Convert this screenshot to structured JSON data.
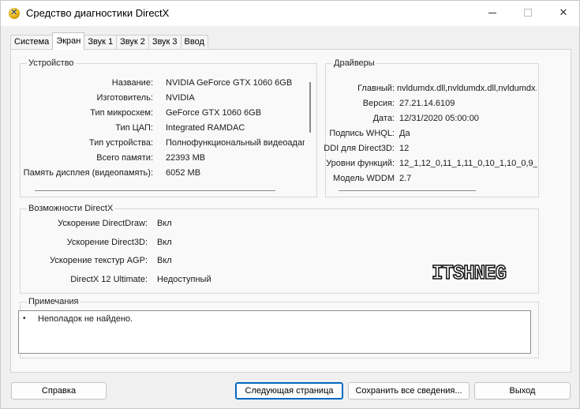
{
  "window": {
    "title": "Средство диагностики DirectX",
    "minimize": "—",
    "maximize": "□",
    "close": "✕"
  },
  "tabs": [
    {
      "label": "Система"
    },
    {
      "label": "Экран",
      "active": true
    },
    {
      "label": "Звук 1"
    },
    {
      "label": "Звук 2"
    },
    {
      "label": "Звук 3"
    },
    {
      "label": "Ввод"
    }
  ],
  "device": {
    "title": "Устройство",
    "rows": [
      {
        "label": "Название:",
        "value": "NVIDIA GeForce GTX 1060 6GB"
      },
      {
        "label": "Изготовитель:",
        "value": "NVIDIA"
      },
      {
        "label": "Тип микросхем:",
        "value": "GeForce GTX 1060 6GB"
      },
      {
        "label": "Тип ЦАП:",
        "value": "Integrated RAMDAC"
      },
      {
        "label": "Тип устройства:",
        "value": "Полнофункциональный видеоадап"
      },
      {
        "label": "Всего памяти:",
        "value": "22393 MB"
      },
      {
        "label": "Память дисплея (видеопамять):",
        "value": "6052 MB"
      }
    ]
  },
  "drivers": {
    "title": "Драйверы",
    "rows": [
      {
        "label": "Главный:",
        "value": "nvldumdx.dll,nvldumdx.dll,nvldumdx.c"
      },
      {
        "label": "Версия:",
        "value": "27.21.14.6109"
      },
      {
        "label": "Дата:",
        "value": "12/31/2020 05:00:00"
      },
      {
        "label": "Подпись WHQL:",
        "value": "Да"
      },
      {
        "label": "DDI для Direct3D:",
        "value": "12"
      },
      {
        "label": "Уровни функций:",
        "value": "12_1,12_0,11_1,11_0,10_1,10_0,9_"
      },
      {
        "label": "Модель WDDM",
        "value": "2.7"
      }
    ]
  },
  "directx": {
    "title": "Возможности DirectX",
    "rows": [
      {
        "label": "Ускорение DirectDraw:",
        "value": "Вкл"
      },
      {
        "label": "Ускорение Direct3D:",
        "value": "Вкл"
      },
      {
        "label": "Ускорение текстур AGP:",
        "value": "Вкл"
      },
      {
        "label": "DirectX 12 Ultimate:",
        "value": "Недоступный"
      }
    ]
  },
  "notes": {
    "title": "Примечания",
    "bullet": "•",
    "text": "Неполадок не найдено."
  },
  "watermark": "ITSHNEG",
  "buttons": {
    "help": "Справка",
    "next": "Следующая страница",
    "save": "Сохранить все сведения...",
    "exit": "Выход"
  }
}
